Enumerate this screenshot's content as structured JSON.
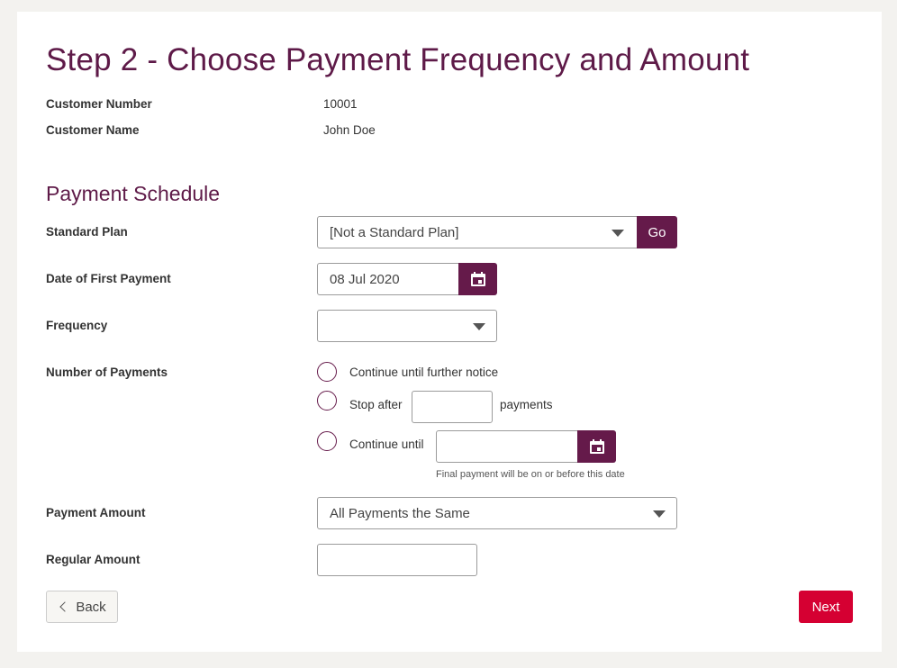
{
  "page": {
    "title": "Step 2 - Choose Payment Frequency and Amount",
    "section_title": "Payment Schedule"
  },
  "customer": {
    "number_label": "Customer Number",
    "number_value": "10001",
    "name_label": "Customer Name",
    "name_value": "John Doe"
  },
  "form": {
    "standard_plan": {
      "label": "Standard Plan",
      "selected": "[Not a Standard Plan]",
      "go_label": "Go"
    },
    "first_payment": {
      "label": "Date of First Payment",
      "value": "08 Jul 2020",
      "icon": "calendar-icon"
    },
    "frequency": {
      "label": "Frequency",
      "selected": ""
    },
    "number_of_payments": {
      "label": "Number of Payments",
      "options": [
        {
          "label": "Continue until further notice",
          "selected": false
        },
        {
          "label": "Stop after",
          "suffix": "payments",
          "input_value": "",
          "selected": false
        },
        {
          "label": "Continue until",
          "input_value": "",
          "hint": "Final payment will be on or before this date",
          "selected": false
        }
      ]
    },
    "payment_amount": {
      "label": "Payment Amount",
      "selected": "All Payments the Same"
    },
    "regular_amount": {
      "label": "Regular Amount",
      "value": ""
    }
  },
  "actions": {
    "back_label": "Back",
    "next_label": "Next"
  },
  "colors": {
    "brand": "#651a4a",
    "primary_action": "#d50032",
    "background": "#f3f2ef"
  }
}
